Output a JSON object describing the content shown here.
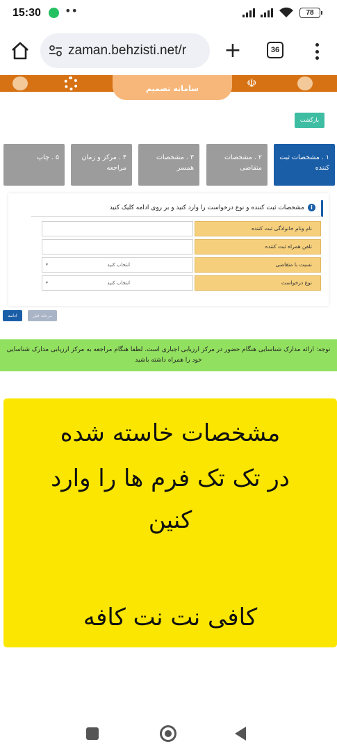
{
  "status_bar": {
    "time": "15:30",
    "dots": "••",
    "battery": "78"
  },
  "browser": {
    "url": "zaman.behzisti.net/r",
    "tab_count": "36"
  },
  "site": {
    "title": "سامانه تصمیم",
    "back_label": "بازگشت"
  },
  "steps": [
    {
      "label": "۱ . مشخصات ثبت کننده",
      "active": true
    },
    {
      "label": "۲ . مشخصات متقاضی",
      "active": false
    },
    {
      "label": "۳ . مشخصات همسر",
      "active": false
    },
    {
      "label": "۴ . مرکز و زمان مراجعه",
      "active": false
    },
    {
      "label": "۵ . چاپ",
      "active": false
    }
  ],
  "form": {
    "instruction": "مشخصات ثبت کننده و نوع درخواست را وارد کنید و بر روی ادامه کلیک کنید",
    "fields": [
      {
        "label": "نام ونام خانوادگی ثبت کننده",
        "value": ""
      },
      {
        "label": "تلفن همراه ثبت کننده",
        "value": ""
      },
      {
        "label": "نسبت با متقاضی",
        "value": "انتخاب کنید"
      },
      {
        "label": "نوع درخواست",
        "value": "انتخاب کنید"
      }
    ],
    "continue_label": "ادامه",
    "prev_label": "مرحله قبل"
  },
  "notice": "توجه: ارائه مدارک شناسایی هنگام حضور در مرکز ارزیابی اجباری است. لطفا هنگام مراجعه به مرکز ارزیابی مدارک شناسایی خود را همراه داشته باشید",
  "overlay": {
    "lines": [
      "مشخصات خاسته شده",
      "در تک تک فرم ها را وارد",
      "کنین",
      "کافی نت نت کافه"
    ]
  },
  "colors": {
    "active_step": "#1a5ea8",
    "inactive_step": "#9c9c9c",
    "header": "#d77214",
    "overlay": "#fae600",
    "notice": "#92e060"
  }
}
